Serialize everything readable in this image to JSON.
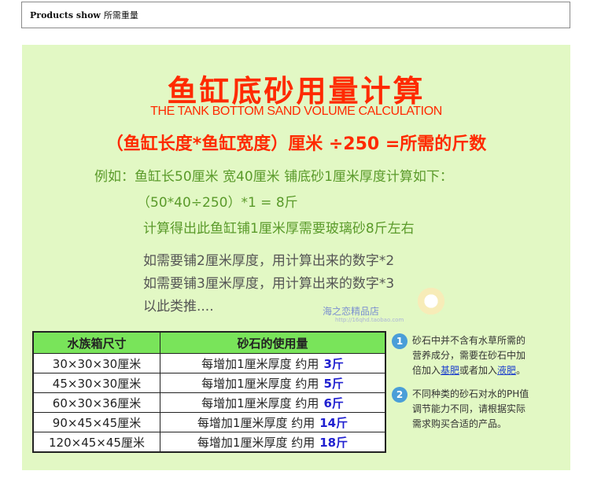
{
  "header": {
    "en": "Products show",
    "zh": "所需重量"
  },
  "title": "鱼缸底砂用量计算",
  "subtitle": "THE TANK BOTTOM SAND VOLUME CALCULATION",
  "formula": "（鱼缸长度*鱼缸宽度）厘米 ÷250 =所需的斤数",
  "example": {
    "line1": "例如：鱼缸长50厘米 宽40厘米 铺底砂1厘米厚度计算如下：",
    "line2": "（50*40÷250）*1 = 8斤",
    "line3": "计算得出此鱼缸铺1厘米厚需要玻璃砂8斤左右"
  },
  "more": {
    "line1": "如需要铺2厘米厚度，用计算出来的数字*2",
    "line2": "如需要铺3厘米厚度，用计算出来的数字*3",
    "line3": "以此类推...."
  },
  "watermark": {
    "text": "海之恋精品店",
    "url": "http://16qhd.taobao.com"
  },
  "table": {
    "headers": [
      "水族箱尺寸",
      "砂石的使用量"
    ],
    "rows": [
      {
        "size": "30×30×30厘米",
        "usage": "每增加1厘米厚度 约用",
        "amount": "3斤"
      },
      {
        "size": "45×30×30厘米",
        "usage": "每增加1厘米厚度 约用",
        "amount": "5斤"
      },
      {
        "size": "60×30×36厘米",
        "usage": "每增加1厘米厚度 约用",
        "amount": "6斤"
      },
      {
        "size": "90×45×45厘米",
        "usage": "每增加1厘米厚度 约用",
        "amount": "14斤"
      },
      {
        "size": "120×45×45厘米",
        "usage": "每增加1厘米厚度 约用",
        "amount": "18斤"
      }
    ]
  },
  "notes": {
    "n1_num": "1",
    "n1_a": "砂石中并不含有水草所需的",
    "n1_b": "营养成分，需要在砂石中加",
    "n1_c": "倍加入",
    "n1_link1": "基肥",
    "n1_d": "或者加入",
    "n1_link2": "液肥",
    "n1_e": "。",
    "n2_num": "2",
    "n2_a": "不同种类的砂石对水的PH值",
    "n2_b": "调节能力不同，请根据实际",
    "n2_c": "需求购买合适的产品。"
  }
}
